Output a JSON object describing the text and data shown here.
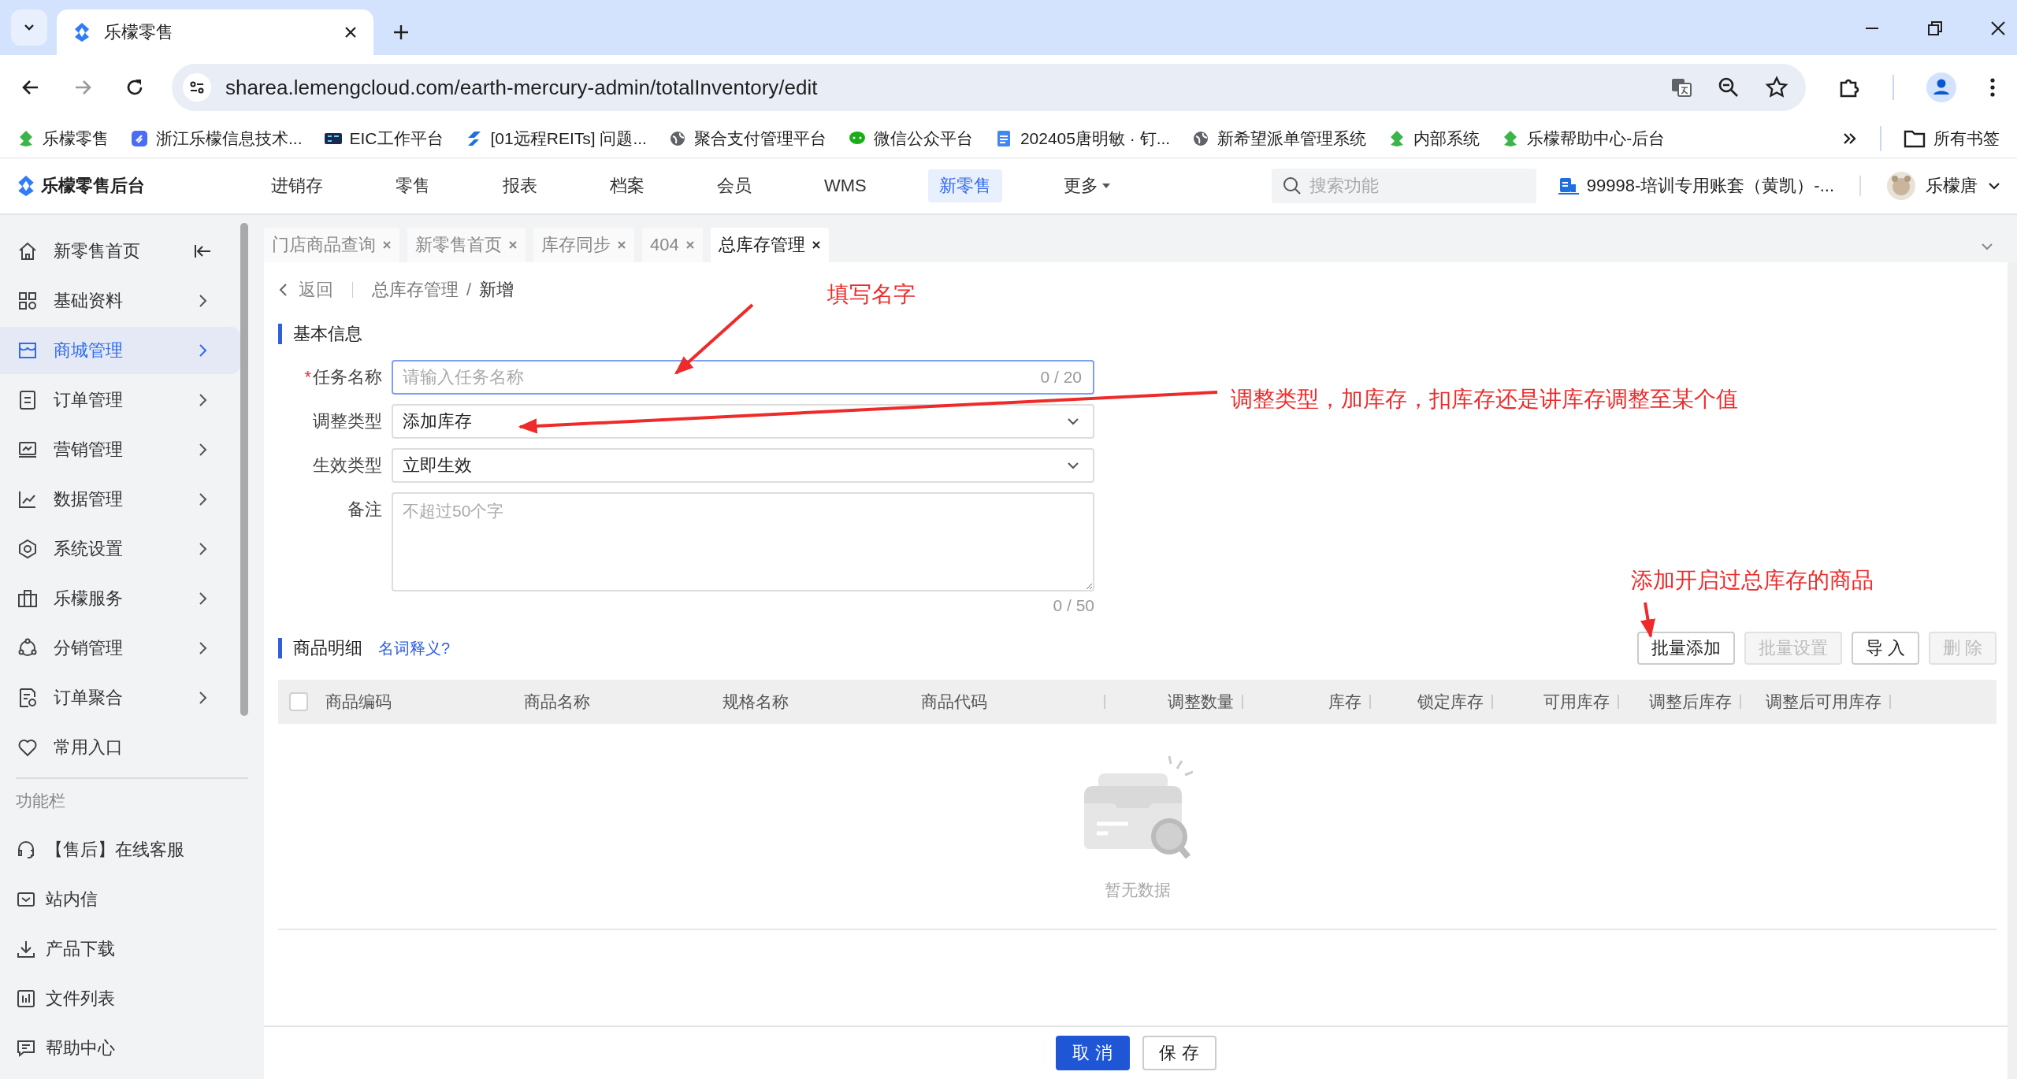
{
  "browser": {
    "tab_title": "乐檬零售",
    "url": "sharea.lemengcloud.com/earth-mercury-admin/totalInventory/edit",
    "bookmarks": [
      "乐檬零售",
      "浙江乐檬信息技术...",
      "EIC工作平台",
      "[01远程REITs] 问题...",
      "聚合支付管理平台",
      "微信公众平台",
      "202405唐明敏 · 钉...",
      "新希望派单管理系统",
      "内部系统",
      "乐檬帮助中心-后台"
    ],
    "bookmarks_folder": "所有书签"
  },
  "header": {
    "logo": "乐檬零售后台",
    "nav": [
      {
        "label": "进销存",
        "selected": false
      },
      {
        "label": "零售",
        "selected": false
      },
      {
        "label": "报表",
        "selected": false
      },
      {
        "label": "档案",
        "selected": false
      },
      {
        "label": "会员",
        "selected": false
      },
      {
        "label": "WMS",
        "selected": false
      },
      {
        "label": "新零售",
        "selected": true
      },
      {
        "label": "更多",
        "selected": false,
        "dropdown": true
      }
    ],
    "search_placeholder": "搜索功能",
    "account": "99998-培训专用账套（黄凯）-...",
    "user": "乐檬唐"
  },
  "sidebar": {
    "items": [
      {
        "label": "新零售首页",
        "selected": false,
        "expandable": false
      },
      {
        "label": "基础资料",
        "selected": false,
        "expandable": true
      },
      {
        "label": "商城管理",
        "selected": true,
        "expandable": true
      },
      {
        "label": "订单管理",
        "selected": false,
        "expandable": true
      },
      {
        "label": "营销管理",
        "selected": false,
        "expandable": true
      },
      {
        "label": "数据管理",
        "selected": false,
        "expandable": true
      },
      {
        "label": "系统设置",
        "selected": false,
        "expandable": true
      },
      {
        "label": "乐檬服务",
        "selected": false,
        "expandable": true
      },
      {
        "label": "分销管理",
        "selected": false,
        "expandable": true
      },
      {
        "label": "订单聚合",
        "selected": false,
        "expandable": true
      },
      {
        "label": "常用入口",
        "selected": false,
        "expandable": false
      }
    ],
    "section": "功能栏",
    "tools": [
      "【售后】在线客服",
      "站内信",
      "产品下载",
      "文件列表",
      "帮助中心"
    ]
  },
  "page_tabs": [
    {
      "label": "门店商品查询",
      "selected": false
    },
    {
      "label": "新零售首页",
      "selected": false
    },
    {
      "label": "库存同步",
      "selected": false
    },
    {
      "label": "404",
      "selected": false
    },
    {
      "label": "总库存管理",
      "selected": true
    }
  ],
  "breadcrumb": {
    "back": "返回",
    "separator": "/",
    "path": [
      "总库存管理",
      "新增"
    ]
  },
  "basic_info": {
    "title": "基本信息",
    "required_mark": "*",
    "fields": [
      {
        "kind": "text",
        "label": "任务名称",
        "required": true,
        "placeholder": "请输入任务名称",
        "counter": "0 / 20"
      },
      {
        "kind": "select",
        "label": "调整类型",
        "required": false,
        "value": "添加库存"
      },
      {
        "kind": "select",
        "label": "生效类型",
        "required": false,
        "value": "立即生效"
      },
      {
        "kind": "textarea",
        "label": "备注",
        "required": false,
        "placeholder": "不超过50个字",
        "counter": "0 / 50"
      }
    ]
  },
  "details": {
    "title": "商品明细",
    "help_link": "名词释义?",
    "buttons": [
      {
        "label": "批量添加",
        "disabled": false
      },
      {
        "label": "批量设置",
        "disabled": true
      },
      {
        "label": "导 入",
        "disabled": false
      },
      {
        "label": "删 除",
        "disabled": true
      }
    ],
    "select_all_checked": false,
    "columns": [
      "商品编码",
      "商品名称",
      "规格名称",
      "商品代码",
      "调整数量",
      "库存",
      "锁定库存",
      "可用库存",
      "调整后库存",
      "调整后可用库存"
    ],
    "empty_text": "暂无数据"
  },
  "footer_buttons": [
    {
      "label": "取 消",
      "primary": true
    },
    {
      "label": "保 存",
      "primary": false
    }
  ],
  "annotations": [
    "填写名字",
    "调整类型，加库存，扣库存还是讲库存调整至某个值",
    "添加开启过总库存的商品"
  ]
}
